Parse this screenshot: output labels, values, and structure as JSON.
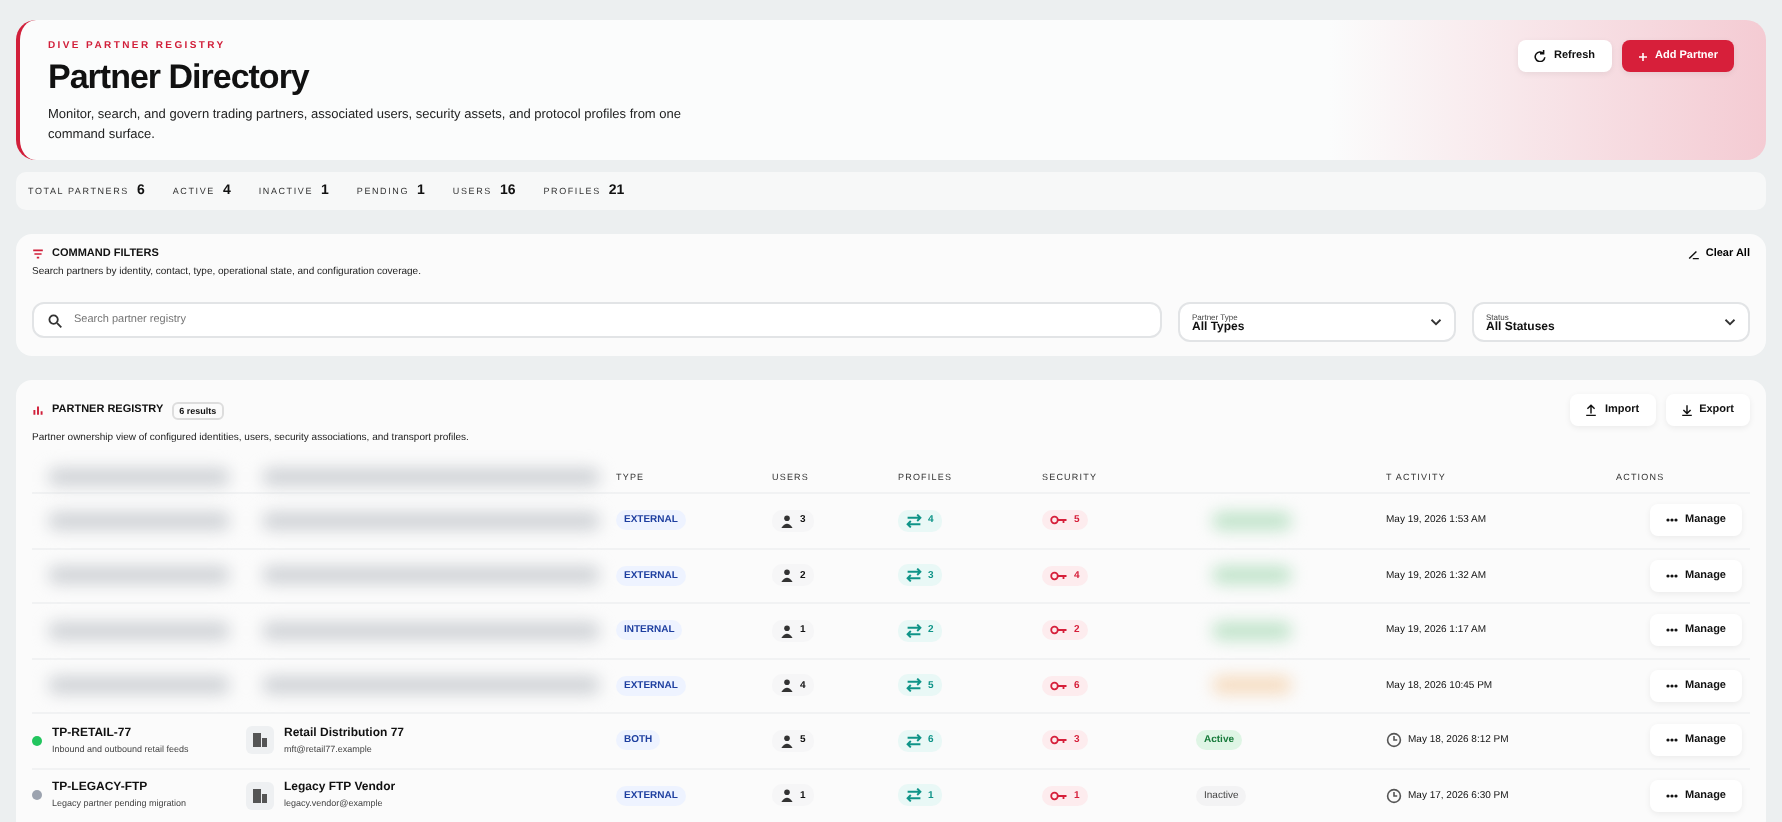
{
  "header": {
    "eyebrow": "DIVE PARTNER REGISTRY",
    "title": "Partner Directory",
    "description": "Monitor, search, and govern trading partners, associated users, security assets, and protocol profiles from one command surface.",
    "buttons": [
      {
        "label": "Refresh",
        "kind": "secondary"
      },
      {
        "label": "Add Partner",
        "kind": "primary"
      }
    ]
  },
  "stats": [
    {
      "label": "TOTAL PARTNERS",
      "value": "6"
    },
    {
      "label": "ACTIVE",
      "value": "4"
    },
    {
      "label": "INACTIVE",
      "value": "1"
    },
    {
      "label": "PENDING",
      "value": "1"
    },
    {
      "label": "USERS",
      "value": "16"
    },
    {
      "label": "PROFILES",
      "value": "21"
    }
  ],
  "filters": {
    "title": "COMMAND FILTERS",
    "description": "Search partners by identity, contact, type, operational state, and configuration coverage.",
    "clear": "Clear All",
    "search": {
      "placeholder": "Search partner registry"
    },
    "selects": [
      {
        "label": "Partner Type",
        "value": "All Types"
      },
      {
        "label": "Status",
        "value": "All Statuses"
      }
    ]
  },
  "registry": {
    "title": "PARTNER REGISTRY",
    "count": "6 results",
    "description": "Partner ownership view of configured identities, users, security associations, and transport profiles.",
    "buttons": [
      "Import",
      "Export"
    ],
    "columns": [
      "TYPE",
      "USERS",
      "PROFILES",
      "SECURITY",
      "T ACTIVITY",
      "ACTIONS"
    ],
    "rows": [
      {
        "kind": "redacted",
        "color": "#bfe3c9",
        "type": "EXTERNAL",
        "users": "3",
        "profiles": "4",
        "security": "5",
        "activity": "May 19, 2026 1:53 AM",
        "action": "Manage"
      },
      {
        "kind": "redacted",
        "color": "#bfe3c9",
        "type": "EXTERNAL",
        "users": "2",
        "profiles": "3",
        "security": "4",
        "activity": "May 19, 2026 1:32 AM",
        "action": "Manage"
      },
      {
        "kind": "redacted",
        "color": "#bfe3c9",
        "type": "INTERNAL",
        "users": "1",
        "profiles": "2",
        "security": "2",
        "activity": "May 19, 2026 1:17 AM",
        "action": "Manage"
      },
      {
        "kind": "redacted",
        "color": "#f6dcc0",
        "type": "EXTERNAL",
        "users": "4",
        "profiles": "5",
        "security": "6",
        "activity": "May 18, 2026 10:45 PM",
        "action": "Manage"
      },
      {
        "kind": "active",
        "color": "#22c55e",
        "code": "TP-RETAIL-77",
        "note": "Inbound and outbound retail feeds",
        "company": "Retail Distribution 77",
        "email": "mft@retail77.example",
        "type": "BOTH",
        "users": "5",
        "profiles": "6",
        "security": "3",
        "status": "Active",
        "activity": "May 18, 2026 8:12 PM",
        "action": "Manage"
      },
      {
        "kind": "inactive",
        "color": "#9ca3af",
        "code": "TP-LEGACY-FTP",
        "note": "Legacy partner pending migration",
        "company": "Legacy FTP Vendor",
        "email": "legacy.vendor@example",
        "type": "EXTERNAL",
        "users": "1",
        "profiles": "1",
        "security": "1",
        "status": "Inactive",
        "activity": "May 17, 2026 6:30 PM",
        "action": "Manage"
      }
    ]
  }
}
